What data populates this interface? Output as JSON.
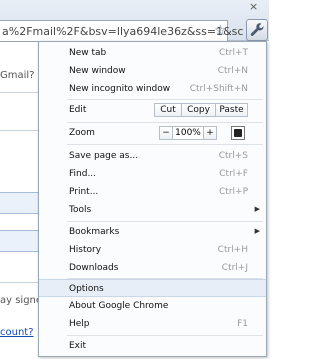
{
  "toolbar": {
    "url_prefix": "a%2Fmail%2F&bsv=llya694le36z&ss=1&sc",
    "star_icon": "star-icon",
    "wrench_icon": "wrench-icon",
    "close_glyph": "×"
  },
  "page": {
    "gmail_text": "Gmail?",
    "stay_signed_text": "ay signe",
    "account_link": "count?"
  },
  "menu": {
    "new_tab": {
      "label": "New tab",
      "shortcut": "Ctrl+T"
    },
    "new_window": {
      "label": "New window",
      "shortcut": "Ctrl+N"
    },
    "new_incognito": {
      "label": "New incognito window",
      "shortcut": "Ctrl+Shift+N"
    },
    "edit": {
      "label": "Edit",
      "cut": "Cut",
      "copy": "Copy",
      "paste": "Paste"
    },
    "zoom": {
      "label": "Zoom",
      "minus": "−",
      "value": "100%",
      "plus": "+"
    },
    "save_page": {
      "label": "Save page as...",
      "shortcut": "Ctrl+S"
    },
    "find": {
      "label": "Find...",
      "shortcut": "Ctrl+F"
    },
    "print": {
      "label": "Print...",
      "shortcut": "Ctrl+P"
    },
    "tools": {
      "label": "Tools"
    },
    "bookmarks": {
      "label": "Bookmarks"
    },
    "history": {
      "label": "History",
      "shortcut": "Ctrl+H"
    },
    "downloads": {
      "label": "Downloads",
      "shortcut": "Ctrl+J"
    },
    "options": {
      "label": "Options"
    },
    "about": {
      "label": "About Google Chrome"
    },
    "help": {
      "label": "Help",
      "shortcut": "F1"
    },
    "exit": {
      "label": "Exit"
    }
  },
  "colors": {
    "highlight": "#e8eef7",
    "shortcut": "#9a9a9a",
    "link": "#1a4db5"
  }
}
